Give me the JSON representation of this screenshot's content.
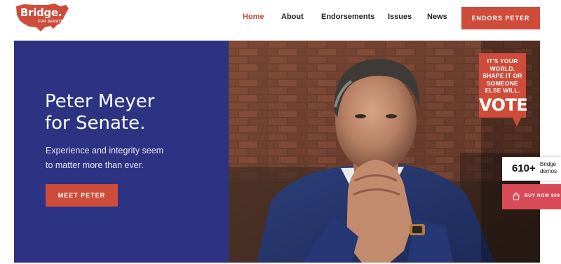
{
  "logo": {
    "text": "Bridge.",
    "subtext": "FOR SENATE"
  },
  "nav": {
    "items": [
      {
        "label": "Home",
        "active": true
      },
      {
        "label": "About",
        "active": false
      },
      {
        "label": "Endorsements",
        "active": false
      },
      {
        "label": "Issues",
        "active": false
      },
      {
        "label": "News",
        "active": false
      }
    ],
    "cta_label": "ENDORS PETER"
  },
  "hero": {
    "title_line1": "Peter Meyer",
    "title_line2": "for Senate.",
    "subtitle_line1": "Experience and integrity seem",
    "subtitle_line2": "to matter more than ever.",
    "button_label": "MEET PETER"
  },
  "sign": {
    "lines": [
      "IT'S YOUR",
      "WORLD.",
      "SHAPE IT OR",
      "SOMEONE",
      "ELSE WILL."
    ],
    "big": "VOTE"
  },
  "demos_badge": {
    "count": "610+",
    "label_line1": "Bridge",
    "label_line2": "demos"
  },
  "buy_badge": {
    "label": "BUY NOW $69"
  },
  "colors": {
    "accent": "#cf4b3a",
    "navy": "#2c3382",
    "buy": "#d94a57"
  }
}
